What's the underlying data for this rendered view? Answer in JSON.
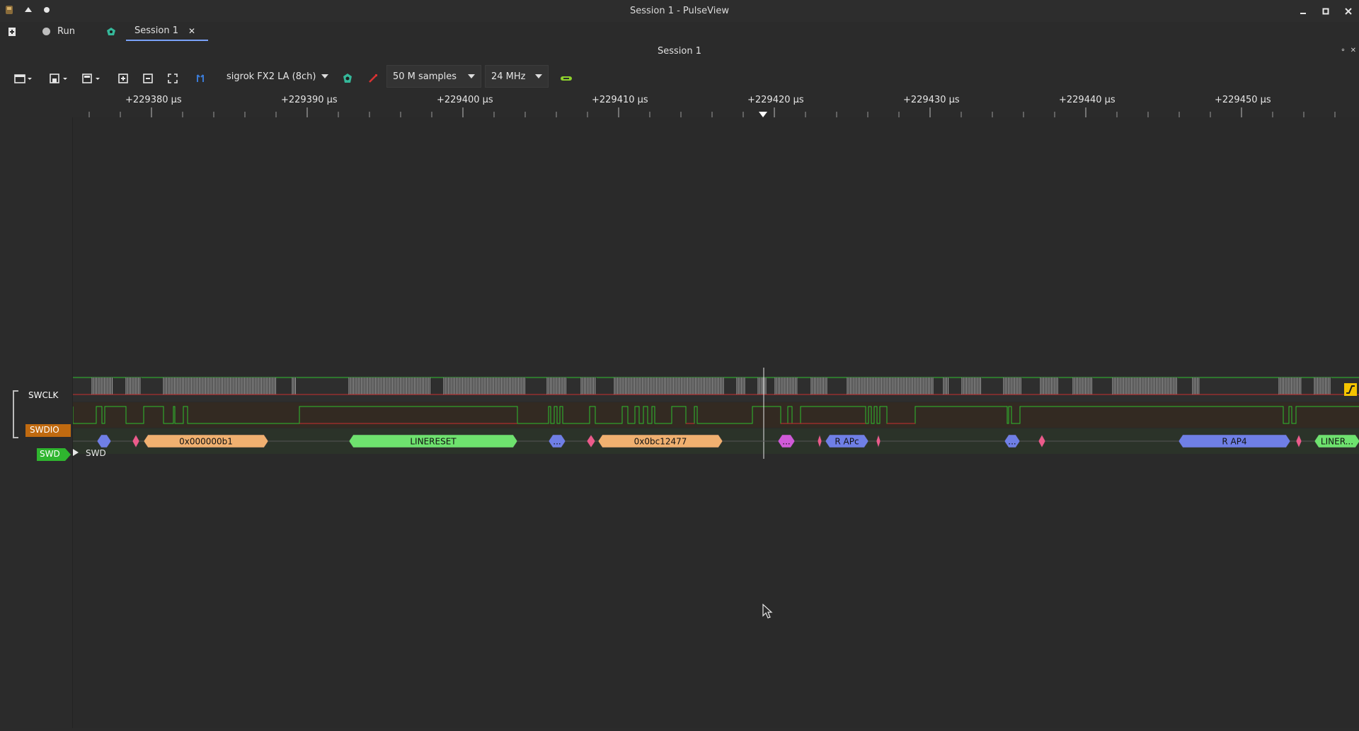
{
  "window": {
    "title": "Session 1 - PulseView"
  },
  "tabs": {
    "run_label": "Run",
    "session_label": "Session 1",
    "close_glyph": "✕"
  },
  "session": {
    "title": "Session 1"
  },
  "toolbar": {
    "device": "sigrok FX2 LA (8ch)",
    "samples": "50 M samples",
    "samplerate": "24 MHz"
  },
  "ruler": {
    "labels": [
      "+229380 µs",
      "+229390 µs",
      "+229400 µs",
      "+229410 µs",
      "+229420 µs",
      "+229430 µs",
      "+229440 µs",
      "+229450 µs"
    ]
  },
  "channels": [
    {
      "name": "SWCLK",
      "color": "#2b2b2b",
      "text_color": "#ffffff"
    },
    {
      "name": "SWDIO",
      "color": "#c06a10",
      "text_color": "#ffffff"
    }
  ],
  "decoder": {
    "name": "SWD",
    "color": "#2fb52f",
    "row_label": "SWD",
    "annotations": [
      {
        "text": "",
        "color": "#6f7fe6"
      },
      {
        "text": "",
        "color": "#ec5b8a"
      },
      {
        "text": "0x000000b1",
        "color": "#f0b070"
      },
      {
        "text": "LINERESET",
        "color": "#6ee26e"
      },
      {
        "text": "...",
        "color": "#6f7fe6"
      },
      {
        "text": "",
        "color": "#ec5b8a"
      },
      {
        "text": "0x0bc12477",
        "color": "#f0b070"
      },
      {
        "text": "...",
        "color": "#d05ad8"
      },
      {
        "text": "",
        "color": "#ec5b8a"
      },
      {
        "text": "R APc",
        "color": "#6f7fe6"
      },
      {
        "text": "",
        "color": "#ec5b8a"
      },
      {
        "text": "...",
        "color": "#6f7fe6"
      },
      {
        "text": "",
        "color": "#ec5b8a"
      },
      {
        "text": "R AP4",
        "color": "#6f7fe6"
      },
      {
        "text": "",
        "color": "#ec5b8a"
      },
      {
        "text": "LINER...",
        "color": "#6ee26e"
      }
    ]
  },
  "colors": {
    "signal_high": "#2fbf2f",
    "signal_low": "#c83030",
    "clock_edges": "#a9a9a9",
    "trigger_marker": "#f5c400"
  },
  "icons": [
    "app-icon",
    "new-session-icon",
    "run-status-icon",
    "session-device-icon",
    "open-icon",
    "save-icon",
    "save-as-icon",
    "zoom-in-icon",
    "zoom-out-icon",
    "zoom-fit-icon",
    "cursor-icon",
    "device-config-icon",
    "probe-icon",
    "decoder-icon",
    "trigger-edge-icon",
    "mouse-pointer-icon"
  ]
}
